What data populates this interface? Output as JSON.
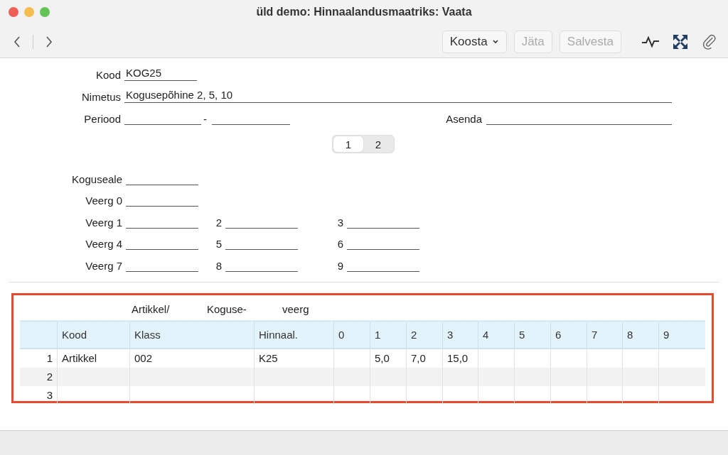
{
  "window": {
    "title": "üld demo: Hinnaalandusmaatriks: Vaata"
  },
  "toolbar": {
    "menu_button": {
      "label": "Koosta"
    },
    "buttons": [
      {
        "label": "Jäta",
        "disabled": true
      },
      {
        "label": "Salvesta",
        "disabled": true
      }
    ]
  },
  "header": {
    "kood": {
      "label": "Kood",
      "value": "KOG25"
    },
    "nimetus": {
      "label": "Nimetus",
      "value": "Kogusepõhine 2, 5, 10"
    },
    "periood": {
      "label": "Periood",
      "separator": "-"
    },
    "asenda": {
      "label": "Asenda"
    }
  },
  "tabs": [
    {
      "label": "1",
      "selected": true
    },
    {
      "label": "2",
      "selected": false
    }
  ],
  "column_fields": [
    [
      {
        "label": "Koguseale"
      }
    ],
    [
      {
        "label": "Veerg 0"
      }
    ],
    [
      {
        "label": "Veerg 1"
      },
      {
        "label": "2"
      },
      {
        "label": "3"
      }
    ],
    [
      {
        "label": "Veerg 4"
      },
      {
        "label": "5"
      },
      {
        "label": "6"
      }
    ],
    [
      {
        "label": "Veerg 7"
      },
      {
        "label": "8"
      },
      {
        "label": "9"
      }
    ]
  ],
  "table": {
    "group_headers": [
      "Artikkel/",
      "Koguse-",
      "veerg"
    ],
    "columns": [
      "Kood",
      "Klass",
      "Hinnaal.",
      "0",
      "1",
      "2",
      "3",
      "4",
      "5",
      "6",
      "7",
      "8",
      "9"
    ],
    "rows": [
      {
        "number": "1",
        "cells": [
          "Artikkel",
          "002",
          "K25",
          "",
          "5,0",
          "7,0",
          "15,0",
          "",
          "",
          "",
          "",
          "",
          ""
        ]
      },
      {
        "number": "2",
        "cells": [
          "",
          "",
          "",
          "",
          "",
          "",
          "",
          "",
          "",
          "",
          "",
          "",
          ""
        ]
      },
      {
        "number": "3",
        "cells": [
          "",
          "",
          "",
          "",
          "",
          "",
          "",
          "",
          "",
          "",
          "",
          "",
          ""
        ]
      }
    ]
  }
}
